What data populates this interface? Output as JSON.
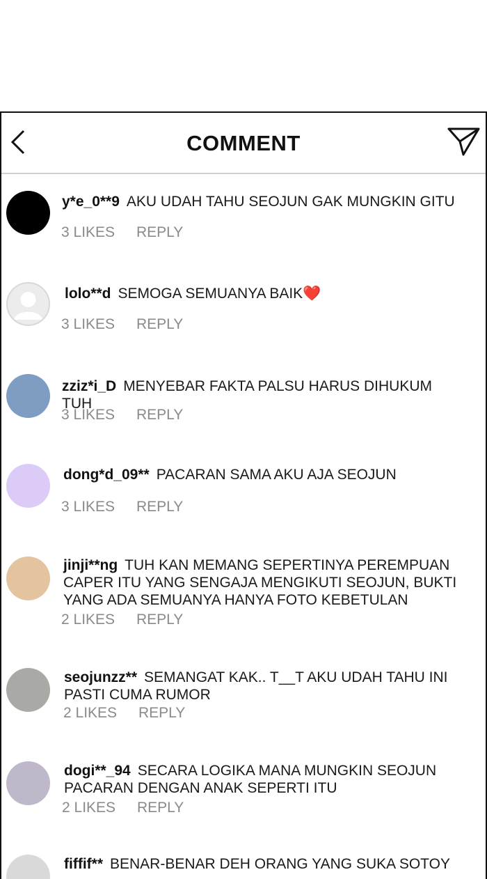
{
  "header": {
    "title": "COMMENT",
    "back_icon": "chevron-left-icon",
    "send_icon": "paper-plane-icon"
  },
  "comments": [
    {
      "username": "y*e_0**9",
      "text": "AKU UDAH TAHU SEOJUN GAK MUNGKIN GITU",
      "likes": "3 LIKES",
      "reply": "REPLY",
      "avatar_color": "#000000"
    },
    {
      "username": "lolo**d",
      "text": "SEMOGA SEMUANYA BAIK",
      "emoji": "❤️",
      "likes": "3 LIKES",
      "reply": "REPLY",
      "avatar_color": "#e6e6e6"
    },
    {
      "username": "zziz*i_D",
      "text": "MENYEBAR FAKTA PALSU HARUS DIHUKUM TUH",
      "likes": "3 LIKES",
      "reply": "REPLY",
      "avatar_color": "#7f9dc2"
    },
    {
      "username": "dong*d_09**",
      "text": "PACARAN SAMA AKU AJA SEOJUN",
      "likes": "3 LIKES",
      "reply": "REPLY",
      "avatar_color": "#dccbf7"
    },
    {
      "username": "jinji**ng",
      "text": "TUH KAN MEMANG SEPERTINYA PEREMPUAN CAPER ITU YANG SENGAJA MENGIKUTI SEOJUN, BUKTI YANG ADA SEMUANYA HANYA FOTO KEBETULAN",
      "likes": "2 LIKES",
      "reply": "REPLY",
      "avatar_color": "#e4c49f"
    },
    {
      "username": "seojunzz**",
      "text": "SEMANGAT KAK.. T__T AKU UDAH TAHU INI PASTI CUMA RUMOR",
      "likes": "2 LIKES",
      "reply": "REPLY",
      "avatar_color": "#a9aaa5"
    },
    {
      "username": "dogi**_94",
      "text": "SECARA LOGIKA MANA MUNGKIN SEOJUN PACARAN DENGAN ANAK SEPERTI ITU",
      "likes": "2 LIKES",
      "reply": "REPLY",
      "avatar_color": "#bfb8cb"
    },
    {
      "username": "fiffif**",
      "text": "BENAR-BENAR DEH ORANG YANG SUKA SOTOY",
      "likes": "",
      "reply": "",
      "avatar_color": "#d9d9d9"
    }
  ]
}
